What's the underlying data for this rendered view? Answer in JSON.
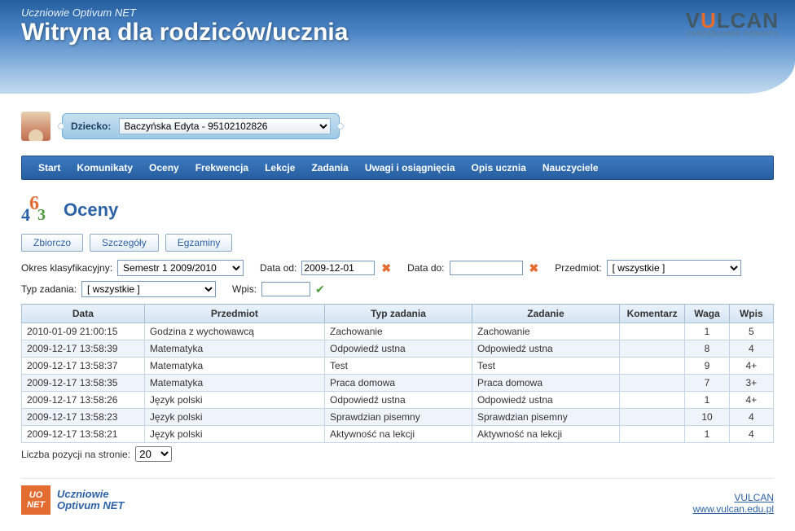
{
  "header": {
    "subtitle": "Uczniowie Optivum NET",
    "title": "Witryna dla rodziców/ucznia",
    "logo_main": "VULCAN",
    "logo_sub": "ZARZĄDZANIE OŚWIATĄ"
  },
  "child": {
    "label": "Dziecko:",
    "selected": "Baczyńska Edyta - 95102102826"
  },
  "nav": {
    "items": [
      "Start",
      "Komunikaty",
      "Oceny",
      "Frekwencja",
      "Lekcje",
      "Zadania",
      "Uwagi i osiągnięcia",
      "Opis ucznia",
      "Nauczyciele"
    ]
  },
  "page": {
    "heading": "Oceny"
  },
  "tabs": [
    "Zbiorczo",
    "Szczegóły",
    "Egzaminy"
  ],
  "filters": {
    "okres_label": "Okres klasyfikacyjny:",
    "okres_value": "Semestr 1 2009/2010",
    "data_od_label": "Data od:",
    "data_od_value": "2009-12-01",
    "data_do_label": "Data do:",
    "data_do_value": "",
    "przedmiot_label": "Przedmiot:",
    "przedmiot_value": "[ wszystkie ]",
    "typ_label": "Typ zadania:",
    "typ_value": "[ wszystkie ]",
    "wpis_label": "Wpis:",
    "wpis_value": ""
  },
  "table": {
    "headers": [
      "Data",
      "Przedmiot",
      "Typ zadania",
      "Zadanie",
      "Komentarz",
      "Waga",
      "Wpis"
    ],
    "rows": [
      [
        "2010-01-09 21:00:15",
        "Godzina z wychowawcą",
        "Zachowanie",
        "Zachowanie",
        "",
        "1",
        "5"
      ],
      [
        "2009-12-17 13:58:39",
        "Matematyka",
        "Odpowiedź ustna",
        "Odpowiedź ustna",
        "",
        "8",
        "4"
      ],
      [
        "2009-12-17 13:58:37",
        "Matematyka",
        "Test",
        "Test",
        "",
        "9",
        "4+"
      ],
      [
        "2009-12-17 13:58:35",
        "Matematyka",
        "Praca domowa",
        "Praca domowa",
        "",
        "7",
        "3+"
      ],
      [
        "2009-12-17 13:58:26",
        "Język polski",
        "Odpowiedź ustna",
        "Odpowiedź ustna",
        "",
        "1",
        "4+"
      ],
      [
        "2009-12-17 13:58:23",
        "Język polski",
        "Sprawdzian pisemny",
        "Sprawdzian pisemny",
        "",
        "10",
        "4"
      ],
      [
        "2009-12-17 13:58:21",
        "Język polski",
        "Aktywność na lekcji",
        "Aktywność na lekcji",
        "",
        "1",
        "4"
      ]
    ]
  },
  "pager": {
    "label": "Liczba pozycji na stronie:",
    "value": "20"
  },
  "footer": {
    "uo_line1": "UO",
    "uo_line2": "NET",
    "brand_line1": "Uczniowie",
    "brand_line2": "Optivum NET",
    "link1": "VULCAN",
    "link2": "www.vulcan.edu.pl"
  }
}
